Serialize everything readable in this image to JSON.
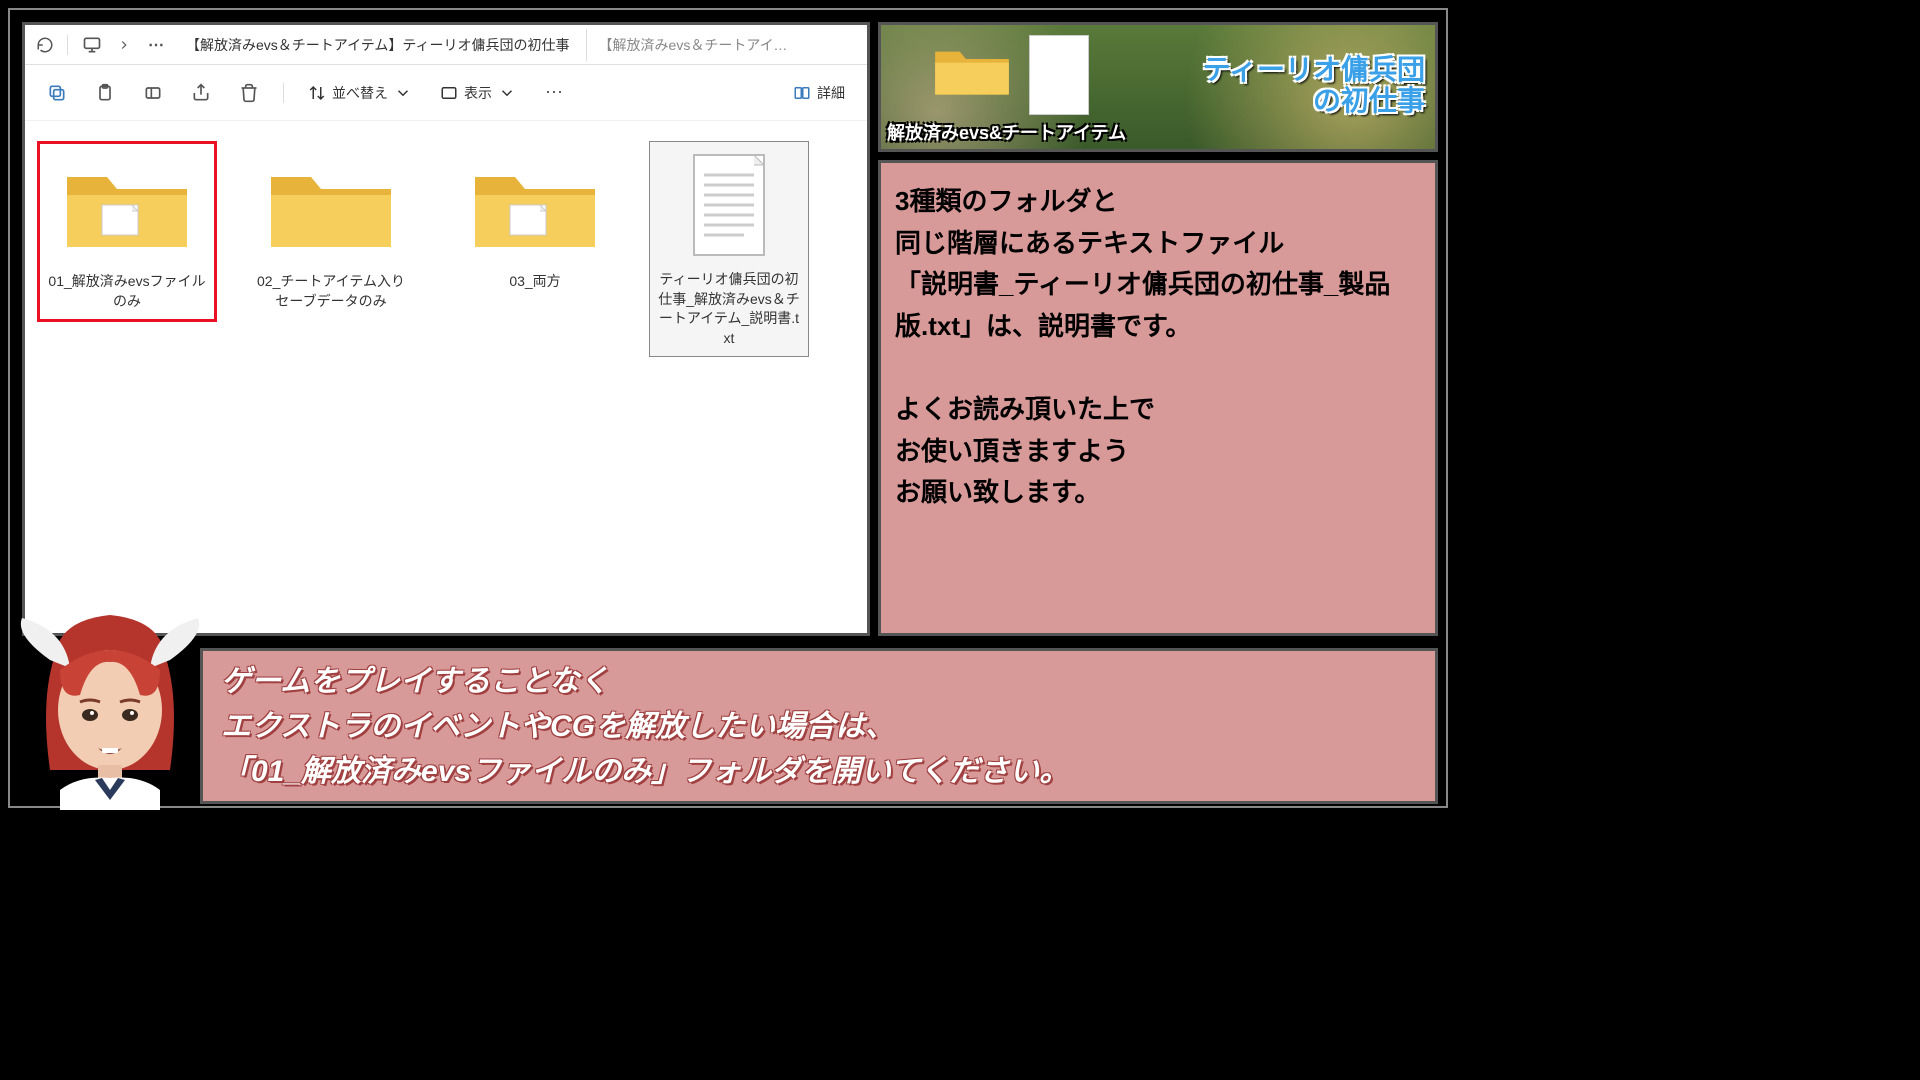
{
  "explorer": {
    "tabs": {
      "active": "【解放済みevs＆チートアイテム】ティーリオ傭兵団の初仕事",
      "inactive": "【解放済みevs＆チートアイテム"
    },
    "toolbar": {
      "sort": "並べ替え",
      "view": "表示",
      "details": "詳細"
    },
    "items": [
      {
        "label": "01_解放済みevsファイルのみ",
        "type": "folder",
        "highlighted": true
      },
      {
        "label": "02_チートアイテム入りセーブデータのみ",
        "type": "folder"
      },
      {
        "label": "03_両方",
        "type": "folder"
      },
      {
        "label": "ティーリオ傭兵団の初仕事_解放済みevs＆チートアイテム_説明書.txt",
        "type": "text",
        "selected": true
      }
    ]
  },
  "banner": {
    "caption": "解放済みevs&チートアイテム",
    "title_line1": "ティーリオ傭兵団",
    "title_line2": "の初仕事"
  },
  "info": {
    "text": "3種類のフォルダと\n同じ階層にあるテキストファイル\n「説明書_ティーリオ傭兵団の初仕事_製品版.txt」は、説明書です。\n\nよくお読み頂いた上で\nお使い頂きますよう\nお願い致します。"
  },
  "dialogue": {
    "text": "ゲームをプレイすることなく\nエクストラのイベントやCGを解放したい場合は、\n「01_解放済みevsファイルのみ」フォルダを開いてください。"
  }
}
